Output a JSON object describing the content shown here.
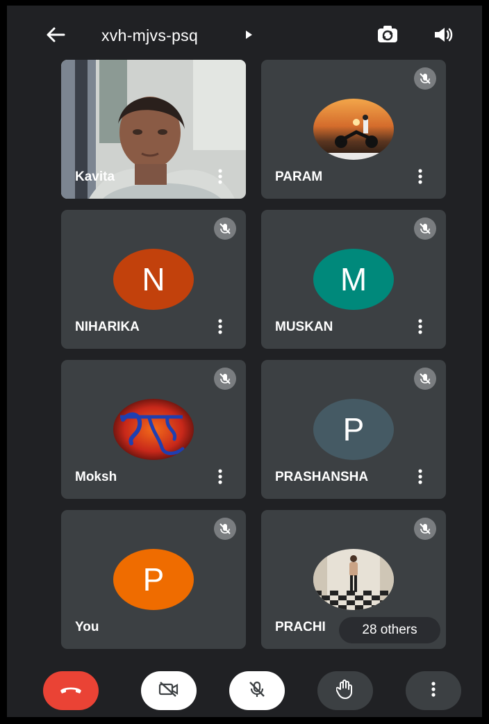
{
  "header": {
    "meeting_code": "xvh-mjvs-psq",
    "icons": {
      "back": "arrow-left-icon",
      "code_arrow": "caret-right-icon",
      "switch_camera": "switch-camera-icon",
      "speaker": "speaker-icon"
    }
  },
  "participants": [
    {
      "name": "Kavita",
      "type": "video",
      "muted": false
    },
    {
      "name": "PARAM",
      "type": "photo",
      "muted": true
    },
    {
      "name": "NIHARIKA",
      "type": "initial",
      "initial": "N",
      "color": "#c2410c",
      "muted": true
    },
    {
      "name": "MUSKAN",
      "type": "initial",
      "initial": "M",
      "color": "#00897b",
      "muted": true
    },
    {
      "name": "Moksh",
      "type": "photo",
      "muted": true
    },
    {
      "name": "PRASHANSHA",
      "type": "initial",
      "initial": "P",
      "color": "#455a64",
      "muted": true
    },
    {
      "name": "You",
      "type": "initial",
      "initial": "P",
      "color": "#ef6c00",
      "muted": false
    },
    {
      "name": "PRACHI",
      "type": "photo",
      "muted": true
    }
  ],
  "others_chip": "28 others",
  "controls": {
    "icons": [
      "end-call-icon",
      "camera-off-icon",
      "mic-off-icon",
      "raise-hand-icon",
      "more-vert-icon"
    ],
    "end_call_color": "#ea4335"
  },
  "colors": {
    "background": "#202124",
    "tile": "#3c4043"
  }
}
